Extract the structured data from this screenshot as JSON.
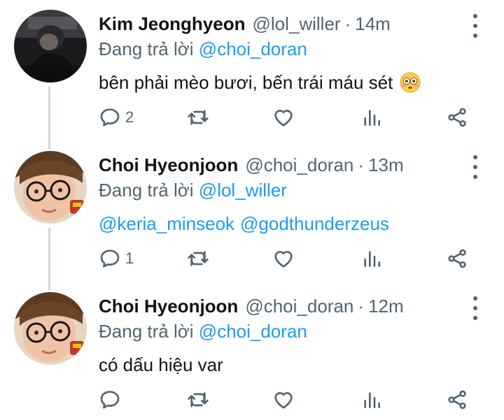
{
  "tweets": [
    {
      "name": "Kim Jeonghyeon",
      "handle": "@lol_willer",
      "separator": "·",
      "time": "14m",
      "reply_prefix": "Đang trả lời",
      "reply_to": "@choi_doran",
      "text": "bên phải mèo bươi, bến trái máu sét",
      "emoji": "flushed-face",
      "reply_count": "2",
      "avatar": "dark-photo"
    },
    {
      "name": "Choi Hyeonjoon",
      "handle": "@choi_doran",
      "separator": "·",
      "time": "13m",
      "reply_prefix": "Đang trả lời",
      "reply_to": "@lol_willer",
      "mentions": [
        "@keria_minseok",
        "@godthunderzeus"
      ],
      "reply_count": "1",
      "avatar": "selfie-glasses"
    },
    {
      "name": "Choi Hyeonjoon",
      "handle": "@choi_doran",
      "separator": "·",
      "time": "12m",
      "reply_prefix": "Đang trả lời",
      "reply_to": "@choi_doran",
      "text": "có dấu hiệu var",
      "reply_count": "",
      "avatar": "selfie-glasses"
    }
  ],
  "icons": {
    "reply": "reply-icon",
    "retweet": "retweet-icon",
    "like": "heart-icon",
    "views": "views-icon",
    "share": "share-icon",
    "more": "more-vertical-icon"
  },
  "colors": {
    "text": "#0f1419",
    "secondary": "#536471",
    "link": "#1d9bf0",
    "thread_line": "#cfd9de"
  }
}
